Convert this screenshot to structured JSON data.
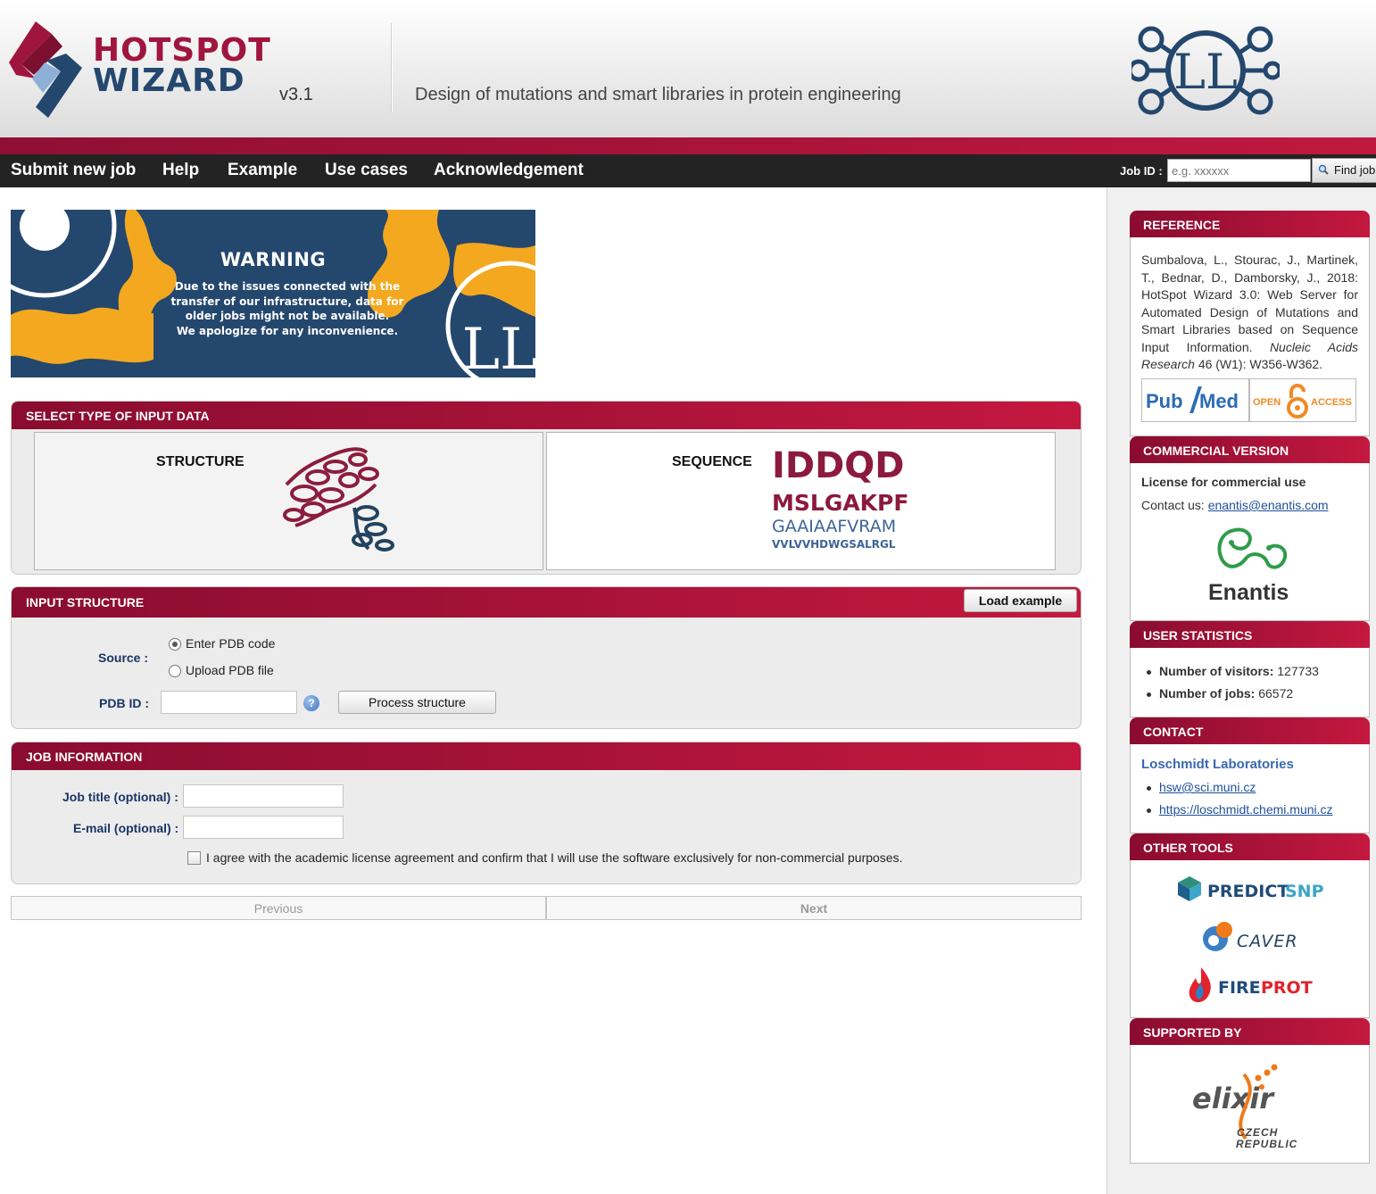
{
  "header": {
    "logo_line1": "HOTSPOT",
    "logo_line2": "WIZARD",
    "version": "v3.1",
    "tagline": "Design of mutations and smart libraries in protein engineering",
    "lab_logo_text": "LL"
  },
  "nav": {
    "items": [
      "Submit new job",
      "Help",
      "Example",
      "Use cases",
      "Acknowledgement"
    ],
    "jobid_label": "Job ID :",
    "jobid_placeholder": "e.g. xxxxxx",
    "find_button": "Find job"
  },
  "warning": {
    "title": "WARNING",
    "lines": [
      "Due to the issues connected with the",
      "transfer of our infrastructure, data for",
      "older jobs might not be available.",
      "We apologize for any inconvenience."
    ],
    "badge_text": "LL"
  },
  "select_type": {
    "heading": "SELECT TYPE OF INPUT DATA",
    "structure_label": "STRUCTURE",
    "sequence_label": "SEQUENCE",
    "sequence_lines": [
      "IDDQD",
      "MSLGAKPF",
      "GAAIAAFVRAM",
      "VVLVVHDWGSALRGL"
    ]
  },
  "input_structure": {
    "heading": "INPUT STRUCTURE",
    "load_example": "Load example",
    "source_label": "Source :",
    "option_pdb_code": "Enter PDB code",
    "option_upload": "Upload PDB file",
    "selected_option": "Enter PDB code",
    "pdb_label": "PDB ID :",
    "pdb_value": "",
    "help_glyph": "?",
    "process_button": "Process structure"
  },
  "job_information": {
    "heading": "JOB INFORMATION",
    "title_label": "Job title (optional) :",
    "title_value": "",
    "email_label": "E-mail (optional) :",
    "email_value": "",
    "agree_text": "I agree with the academic license agreement and confirm that I will use the software exclusively for non-commercial purposes.",
    "agree_checked": false
  },
  "pager": {
    "previous": "Previous",
    "next": "Next"
  },
  "sidebar": {
    "reference": {
      "heading": "REFERENCE",
      "citation_pre": "Sumbalova, L., Stourac, J., Martinek, T., Bednar, D., Damborsky, J., 2018: HotSpot Wizard 3.0: Web Server for Automated Design of Mutations and Smart Libraries based on Sequence Input Information.",
      "journal": "Nucleic Acids Research",
      "citation_post": "46 (W1): W356-W362.",
      "pubmed_pub": "Pub",
      "pubmed_med": "Med",
      "open_access_open": "OPEN",
      "open_access_access": "ACCESS"
    },
    "commercial": {
      "heading": "COMMERCIAL VERSION",
      "license_text": "License for commercial use",
      "contact_prefix": "Contact us:",
      "contact_email": "enantis@enantis.com",
      "logo_text": "Enantis"
    },
    "stats": {
      "heading": "USER STATISTICS",
      "visitors_label": "Number of visitors:",
      "visitors_value": "127733",
      "jobs_label": "Number of jobs:",
      "jobs_value": "66572"
    },
    "contact": {
      "heading": "CONTACT",
      "lab_name": "Loschmidt Laboratories",
      "email": "hsw@sci.muni.cz",
      "website": "https://loschmidt.chemi.muni.cz"
    },
    "other_tools": {
      "heading": "OTHER TOOLS",
      "predictsnp_a": "PREDICT",
      "predictsnp_b": "SNP",
      "caver": "CAVER",
      "fireprot_a": "FIRE",
      "fireprot_b": "PROT"
    },
    "supported": {
      "heading": "SUPPORTED BY",
      "elixir": "elixir",
      "elixir_sub1": "CZECH",
      "elixir_sub2": "REPUBLIC"
    }
  },
  "colors": {
    "brand_red": "#a0153e",
    "brand_blue": "#24476e",
    "nav_bg": "#232323"
  }
}
